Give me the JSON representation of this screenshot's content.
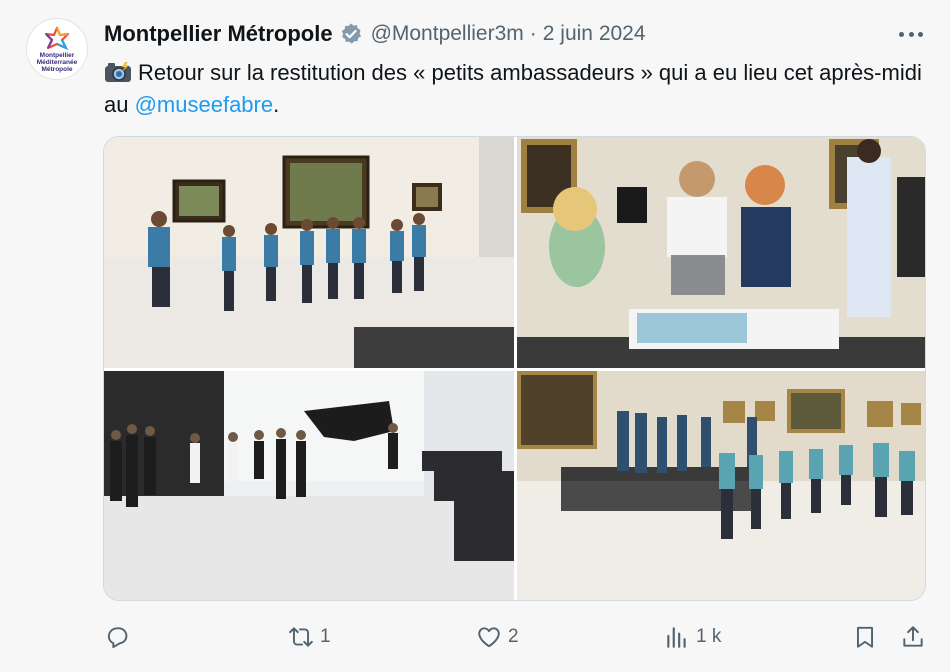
{
  "author": {
    "name": "Montpellier Métropole",
    "handle": "@Montpellier3m",
    "separator": "·",
    "date": "2 juin 2024",
    "avatar_logo_text": [
      "Montpellier",
      "Méditerranée",
      "Métropole"
    ]
  },
  "tweet": {
    "emoji_icon": "camera-with-flash-icon",
    "text_before_mention": "Retour sur la restitution des « petits ambassadeurs » qui a eu lieu cet après-midi au ",
    "mention": "@museefabre",
    "text_after_mention": "."
  },
  "media": {
    "photo_count": 4
  },
  "actions": {
    "reply": {
      "icon": "reply-icon",
      "count": ""
    },
    "retweet": {
      "icon": "retweet-icon",
      "count": "1"
    },
    "like": {
      "icon": "heart-icon",
      "count": "2"
    },
    "views": {
      "icon": "views-icon",
      "count": "1 k"
    },
    "bookmark": {
      "icon": "bookmark-icon"
    },
    "share": {
      "icon": "share-icon"
    }
  },
  "colors": {
    "text": "#0f1419",
    "secondary": "#536471",
    "link": "#1d9bf0",
    "background": "#f7f7f7"
  }
}
